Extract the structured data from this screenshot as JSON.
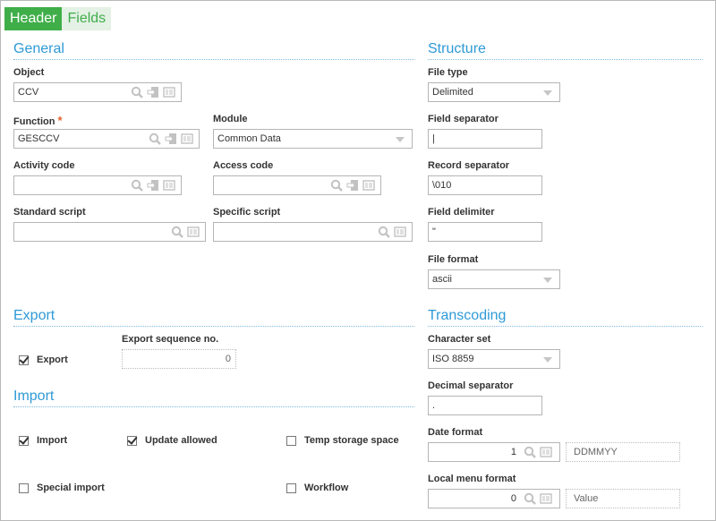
{
  "tabs": {
    "header": "Header",
    "fields": "Fields"
  },
  "general": {
    "title": "General",
    "object_label": "Object",
    "object_value": "CCV",
    "function_label": "Function",
    "function_required": "*",
    "function_value": "GESCCV",
    "module_label": "Module",
    "module_value": "Common Data",
    "activity_label": "Activity code",
    "activity_value": "",
    "access_label": "Access code",
    "access_value": "",
    "standard_script_label": "Standard script",
    "standard_script_value": "",
    "specific_script_label": "Specific script",
    "specific_script_value": ""
  },
  "structure": {
    "title": "Structure",
    "file_type_label": "File type",
    "file_type_value": "Delimited",
    "field_separator_label": "Field separator",
    "field_separator_value": "|",
    "record_separator_label": "Record separator",
    "record_separator_value": "\\010",
    "field_delimiter_label": "Field delimiter",
    "field_delimiter_value": "\"",
    "file_format_label": "File format",
    "file_format_value": "ascii"
  },
  "export": {
    "title": "Export",
    "export_label": "Export",
    "export_checked": true,
    "sequence_label": "Export sequence no.",
    "sequence_value": "0"
  },
  "import": {
    "title": "Import",
    "import_label": "Import",
    "import_checked": true,
    "update_label": "Update allowed",
    "update_checked": true,
    "temp_label": "Temp storage space",
    "temp_checked": false,
    "special_label": "Special import",
    "special_checked": false,
    "workflow_label": "Workflow",
    "workflow_checked": false
  },
  "transcoding": {
    "title": "Transcoding",
    "charset_label": "Character set",
    "charset_value": "ISO 8859",
    "decimal_label": "Decimal separator",
    "decimal_value": ".",
    "date_label": "Date format",
    "date_value": "1",
    "date_desc": "DDMMYY",
    "menu_label": "Local menu format",
    "menu_value": "0",
    "menu_desc": "Value"
  },
  "colors": {
    "tab_active": "#3fae49",
    "section_title": "#2e9ad6",
    "required": "#e0612a"
  }
}
